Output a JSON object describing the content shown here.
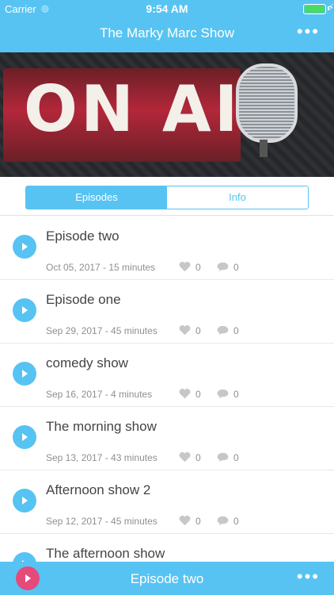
{
  "status_bar": {
    "carrier": "Carrier",
    "time": "9:54 AM"
  },
  "header": {
    "title": "The Marky Marc Show",
    "more_icon": "more-icon"
  },
  "hero": {
    "text": "ON AIR"
  },
  "tabs": [
    {
      "label": "Episodes",
      "selected": true
    },
    {
      "label": "Info",
      "selected": false
    }
  ],
  "episodes": [
    {
      "title": "Episode two",
      "meta": "Oct 05, 2017 - 15 minutes",
      "likes": "0",
      "comments": "0"
    },
    {
      "title": "Episode one",
      "meta": "Sep 29, 2017 - 45 minutes",
      "likes": "0",
      "comments": "0"
    },
    {
      "title": "comedy show",
      "meta": "Sep 16, 2017 - 4 minutes",
      "likes": "0",
      "comments": "0"
    },
    {
      "title": "The morning show",
      "meta": "Sep 13, 2017 - 43 minutes",
      "likes": "0",
      "comments": "0"
    },
    {
      "title": "Afternoon show 2",
      "meta": "Sep 12, 2017 - 45 minutes",
      "likes": "0",
      "comments": "0"
    },
    {
      "title": "The afternoon show",
      "meta": "",
      "likes": "",
      "comments": ""
    }
  ],
  "player": {
    "title": "Episode two"
  },
  "colors": {
    "accent": "#57c3f2",
    "play_pink": "#e54a7a"
  }
}
